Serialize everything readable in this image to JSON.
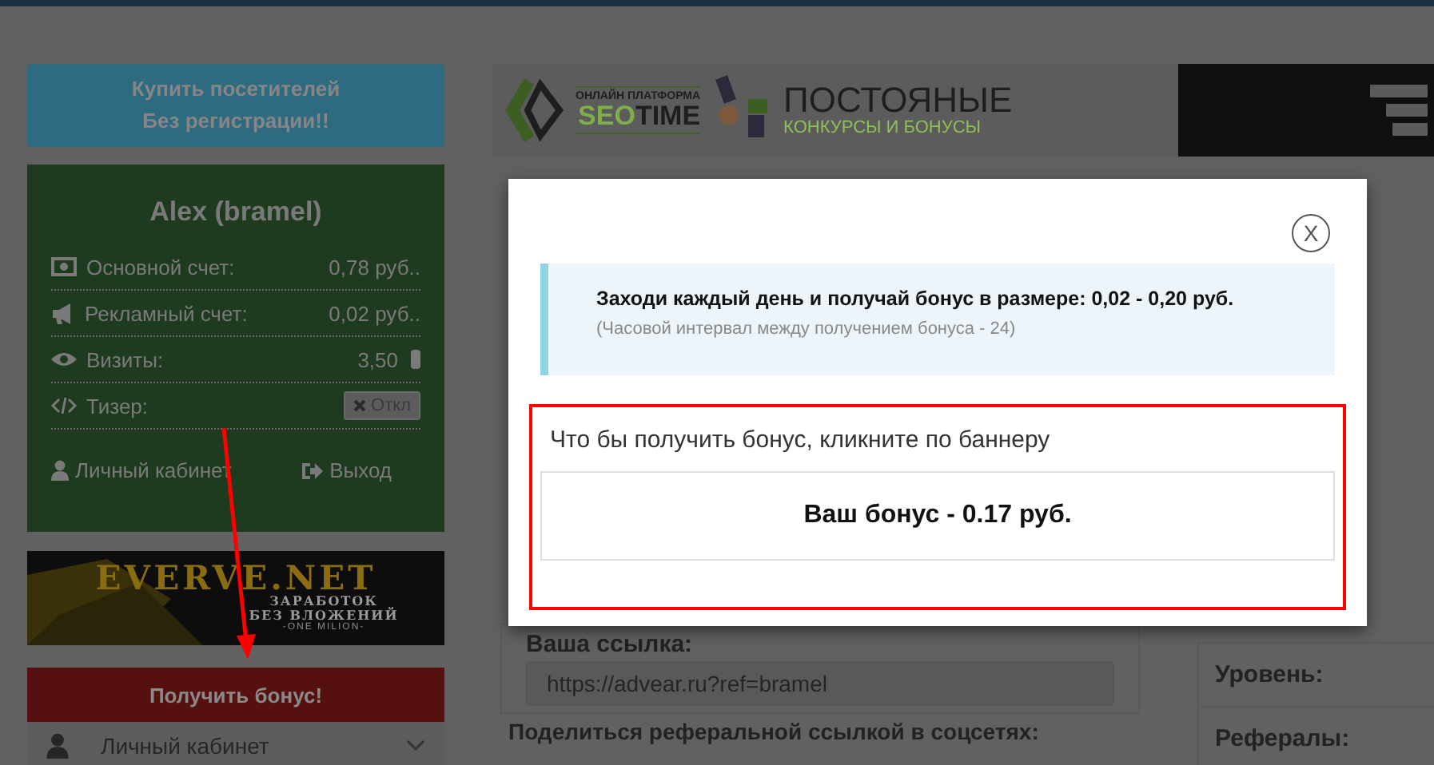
{
  "sidebar": {
    "buy_button": [
      "Купить посетителей",
      "Без регистрации!!"
    ],
    "profile": {
      "name": "Alex (bramel)",
      "rows": [
        {
          "kind": "cash",
          "label": "Основной счет:",
          "value": "0,78 руб.."
        },
        {
          "kind": "megaphone",
          "label": "Рекламный счет:",
          "value": "0,02 руб.."
        },
        {
          "kind": "eye",
          "label": "Визиты:",
          "value": "3,50"
        },
        {
          "kind": "code",
          "label": "Тизер:",
          "toggle": "Откл"
        }
      ],
      "links": [
        {
          "kind": "user",
          "label": "Личный кабинет"
        },
        {
          "kind": "exit",
          "label": "Выход"
        }
      ]
    },
    "banner": {
      "title": "EVERVE.NET",
      "line_1": "ЗАРАБОТОК",
      "line_2": "БЕЗ ВЛОЖЕНИЙ",
      "line_3": "-ONE MILION-"
    },
    "bonus_button": "Получить бонус!",
    "menu": [
      {
        "label": "Личный кабинет"
      }
    ]
  },
  "top_banner": {
    "caption": "ОНЛАЙН ПЛАТФОРМА",
    "brand_1": "SEO",
    "brand_2": "TIME",
    "headline": "ПОСТОЯНЫЕ",
    "subline": "КОНКУРСЫ И БОНУСЫ"
  },
  "referral": {
    "link_label": "Ваша ссылка:",
    "link_value": "https://advear.ru?ref=bramel",
    "share_label": "Поделиться реферальной ссылкой в соцсетях:"
  },
  "stats": {
    "rows": [
      "Уровень:",
      "Рефералы:"
    ]
  },
  "modal": {
    "close": "X",
    "info_title": "Заходи каждый день и получай бонус в размере: 0,02 - 0,20 руб.",
    "info_note": "(Часовой интервал между получением бонуса - 24)",
    "prompt": "Что бы получить бонус, кликните по баннеру",
    "bonus": "Ваш бонус - 0.17 руб."
  }
}
